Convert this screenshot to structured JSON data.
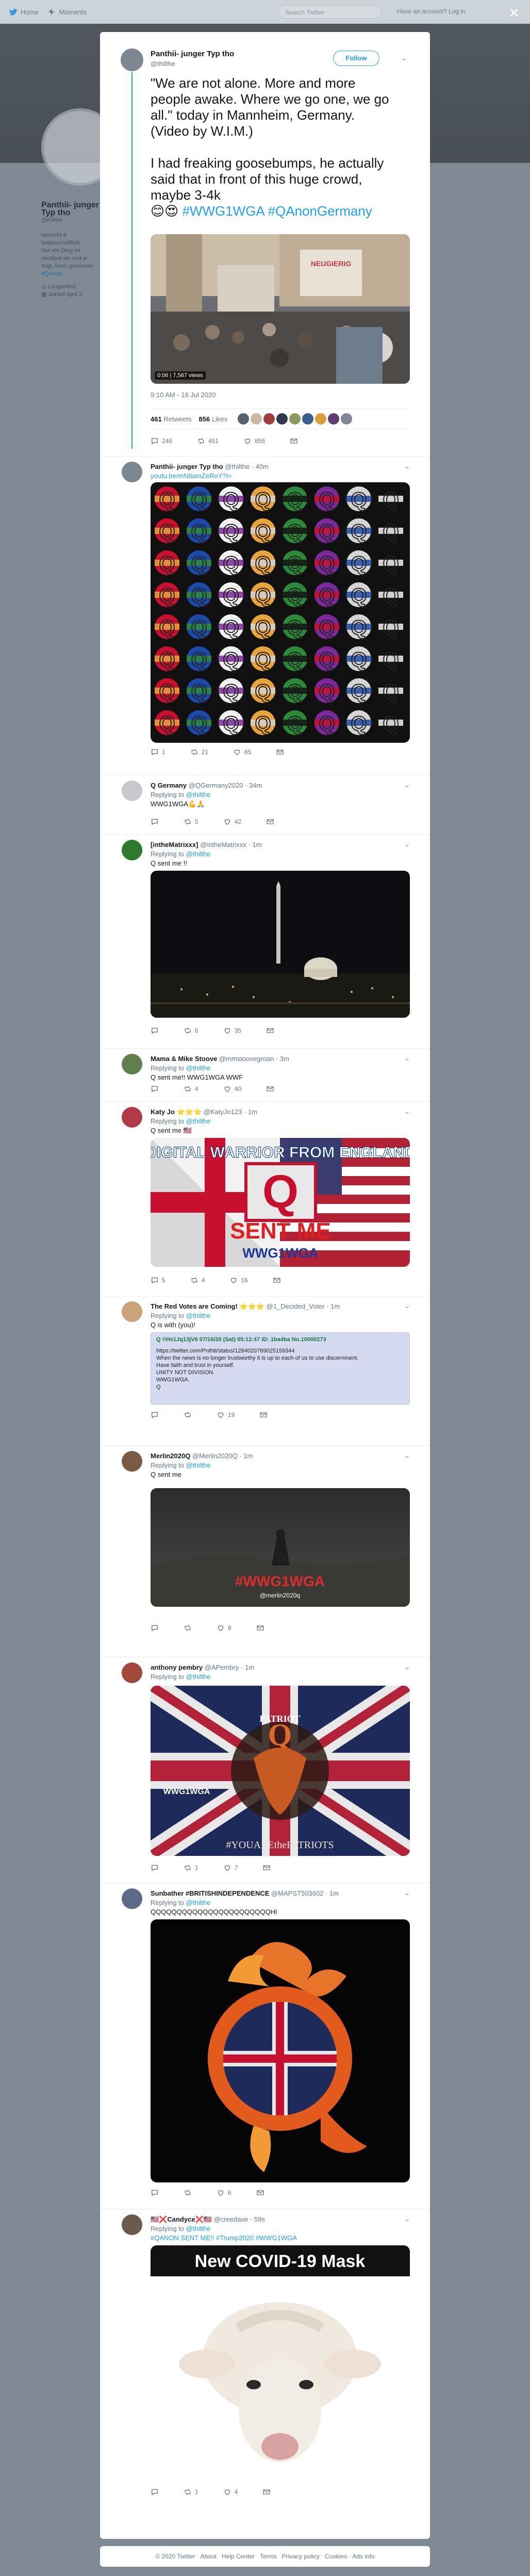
{
  "nav": {
    "home_label": "Home",
    "moments_label": "Moments",
    "search_placeholder": "Search Twitter",
    "login_text": "Have an account? Log in"
  },
  "background": {
    "profile_name": "Panthii- junger Typ tho",
    "handle": "@thilthe",
    "bio_lines": [
      "verrückt & leidenschaftlich",
      "Nur ein Ding im",
      "verdient sie und w",
      "folgt, kann gewinnen",
      "#QAnon"
    ],
    "location": "Langenfeld",
    "joined": "Joined April 2"
  },
  "main_tweet": {
    "name": "Panthii- junger Typ tho",
    "handle": "@thilthe",
    "follow_label": "Follow",
    "text_1": "\"We are not alone. More and more people awake. Where we go one, we go all.\" today in Mannheim, Germany. (Video by W.I.M.)",
    "text_2": "I had freaking goosebumps, he actually said that in front of this huge crowd, maybe 3-4k",
    "emojis": "😊😍",
    "hashtags": "#WWG1WGA #QAnonGermany",
    "video_duration": "0:06",
    "video_views": "7,567 views",
    "video_sign": "NEUGIERIG",
    "timestamp": "9:10 AM - 16 Jul 2020",
    "retweets_count": "461",
    "retweets_label": "Retweets",
    "likes_count": "856",
    "likes_label": "Likes",
    "reply_count": "246",
    "retweet_count": "451",
    "like_count": "856"
  },
  "replies": [
    {
      "name": "Panthii- junger Typ tho",
      "handle": "@thilthe · 40m",
      "link": "youtu.be/mN6amZeRoY?t=",
      "reply_count": "1",
      "retweet_count": "21",
      "like_count": "85"
    },
    {
      "name": "Q Germany",
      "handle": "@QGermany2020 · 34m",
      "replying_label": "Replying to",
      "replying_to": "@thilthe",
      "text": "WWG1WGA💪🙏",
      "retweet_count": "5",
      "like_count": "42"
    },
    {
      "name": "[intheMatrixxx]",
      "handle": "@intheMatrixxx · 1m",
      "replying_label": "Replying to",
      "replying_to": "@thilthe",
      "text": "Q sent me !!",
      "retweet_count": "6",
      "like_count": "35"
    },
    {
      "name": "Mama & Mike Stoove",
      "handle": "@mmstoovegroan · 3m",
      "replying_label": "Replying to",
      "replying_to": "@thilthe",
      "text": "Q sent me!! WWG1WGA WWF",
      "retweet_count": "4",
      "like_count": "40"
    },
    {
      "name": "Katy Jo ⭐⭐⭐",
      "handle": "@KatyJo123 · 1m",
      "replying_label": "Replying to",
      "replying_to": "@thilthe",
      "text": "Q sent me 🇺🇸",
      "image_top": "DIGITAL WARRIOR FROM ENGLAND",
      "image_mid": "SENT ME",
      "image_bottom": "WWG1WGA",
      "reply_count": "5",
      "retweet_count": "4",
      "like_count": "16"
    },
    {
      "name": "The Red Votes are Coming! ⭐⭐⭐",
      "handle": "@1_Decided_Voter · 1m",
      "replying_label": "Replying to",
      "replying_to": "@thilthe",
      "text": "Q is with (you)!",
      "q_header": "Q !!Hs1Jq13jV6  07/16/20 (Sat) 05:12:47  ID: 1ba4ba  No.10000273",
      "q_line1": "https://twitter.com/Pnthti/status/1284020769025159344",
      "q_line2": "When the news is no longer trustworthy it is up to each of us to use discernment.",
      "q_line3": "Have faith and trust in yourself.",
      "q_line4": "UNITY NOT DIVISION.",
      "q_line5": "WWG1WGA.",
      "q_line6": "Q",
      "like_count": "19"
    },
    {
      "name": "Merlin2020Q",
      "handle": "@Merlin2020Q · 1m",
      "replying_label": "Replying to",
      "replying_to": "@thilthe",
      "text": "Q sent me",
      "image_text": "#WWG1WGA",
      "image_handle": "@merlin2020q",
      "like_count": "8"
    },
    {
      "name": "anthony pembry",
      "handle": "@APembry · 1m",
      "replying_label": "Replying to",
      "replying_to": "@thilthe",
      "image_top": "PATRIOT",
      "image_mid": "WWG1WGA",
      "image_bottom": "#YOUAREthePATRIOTS",
      "retweet_count": "1",
      "like_count": "7"
    },
    {
      "name": "Sunbather #BRITISHINDEPENDENCE",
      "handle": "@MAPST503602 · 1m",
      "replying_label": "Replying to",
      "replying_to": "@thilthe",
      "text": "QQQQQQQQQQQQQQQQQQQQQQQHI",
      "like_count": "6"
    },
    {
      "name": "🇺🇸❌Candyce❌🇺🇸",
      "handle": "@creedave · 59s",
      "replying_label": "Replying to",
      "replying_to": "@thilthe",
      "text": "#QANON SENT ME!! #Trump2020 #WWG1WGA",
      "image_title": "New COVID-19 Mask",
      "retweet_count": "1",
      "like_count": "4"
    }
  ],
  "footer": {
    "links": [
      "© 2020 Twitter",
      "About",
      "Help Center",
      "Terms",
      "Privacy policy",
      "Cookies",
      "Ads info"
    ]
  },
  "colors": {
    "accent": "#1da1f2",
    "overlay": "#7f8a94"
  }
}
